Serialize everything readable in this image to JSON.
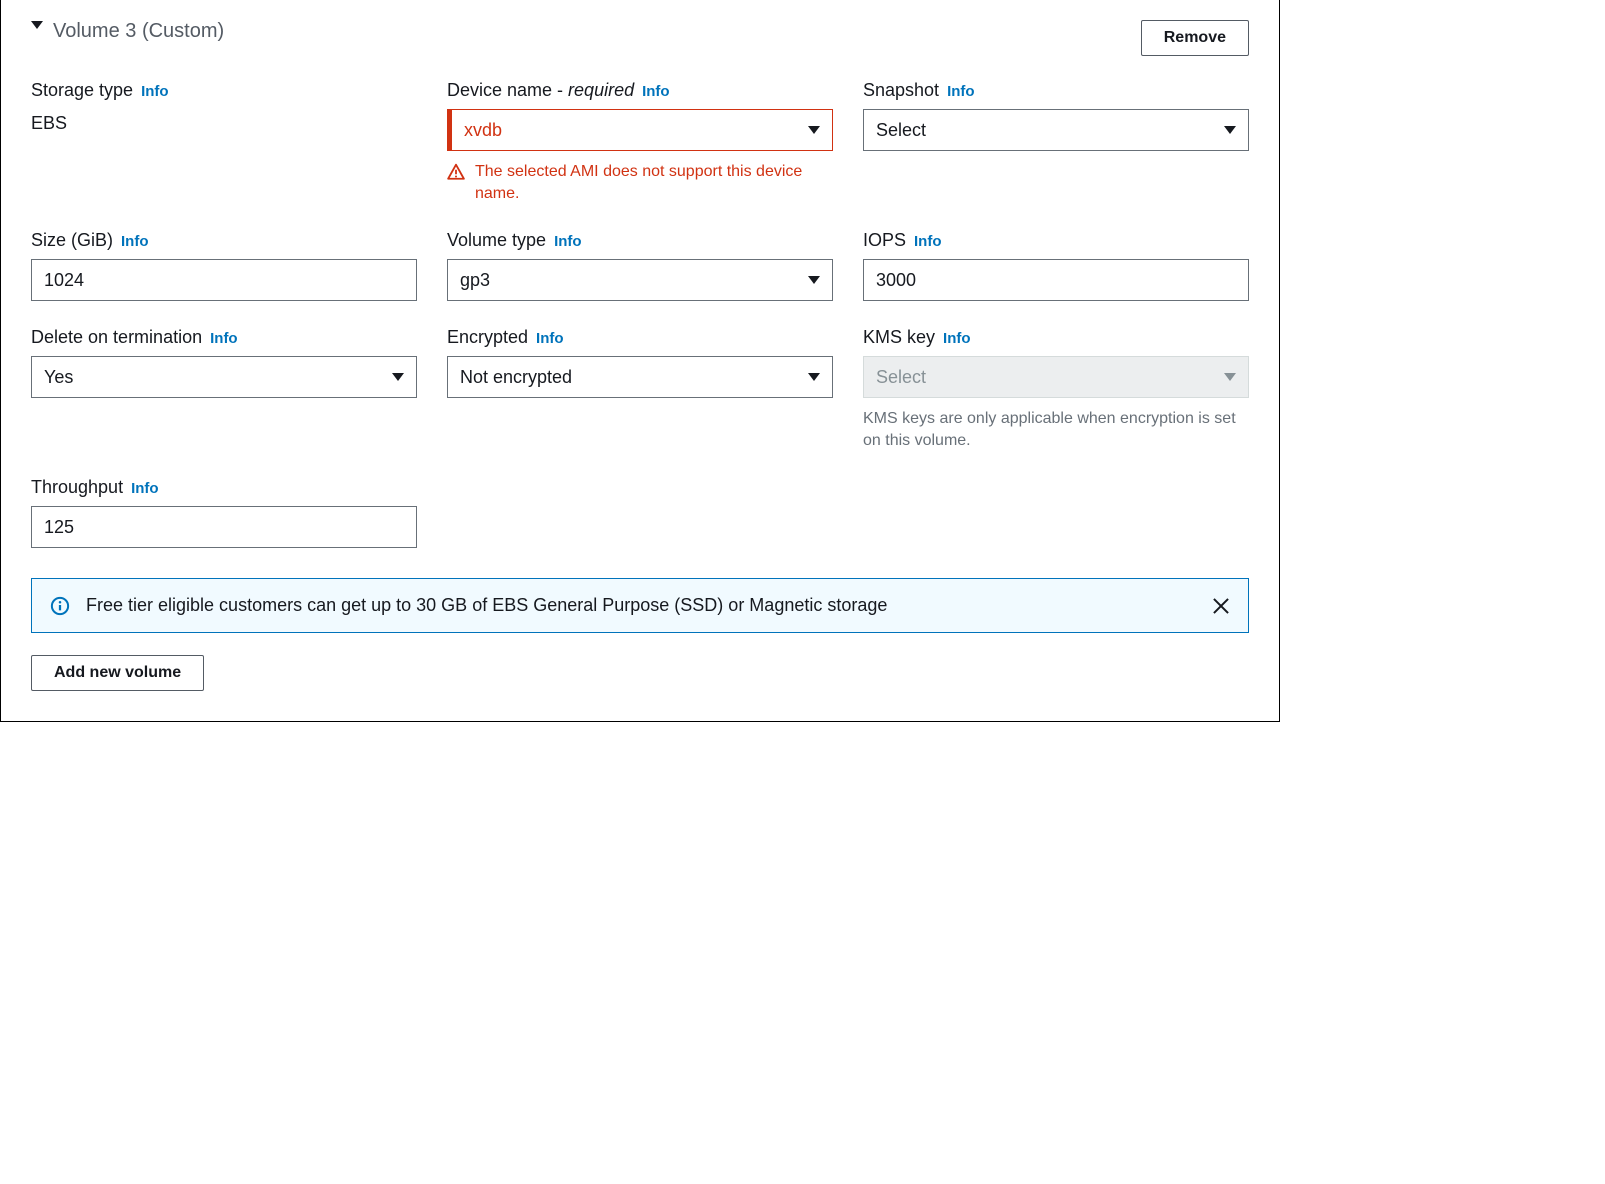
{
  "header": {
    "title": "Volume 3 (Custom)",
    "remove_label": "Remove"
  },
  "info_label": "Info",
  "fields": {
    "storage_type": {
      "label": "Storage type",
      "value": "EBS"
    },
    "device_name": {
      "label": "Device name - ",
      "required_label": "required",
      "value": "xvdb",
      "error": "The selected AMI does not support this device name."
    },
    "snapshot": {
      "label": "Snapshot",
      "value": "Select"
    },
    "size": {
      "label": "Size (GiB)",
      "value": "1024"
    },
    "volume_type": {
      "label": "Volume type",
      "value": "gp3"
    },
    "iops": {
      "label": "IOPS",
      "value": "3000"
    },
    "delete_on_term": {
      "label": "Delete on termination",
      "value": "Yes"
    },
    "encrypted": {
      "label": "Encrypted",
      "value": "Not encrypted"
    },
    "kms_key": {
      "label": "KMS key",
      "value": "Select",
      "help": "KMS keys are only applicable when encryption is set on this volume."
    },
    "throughput": {
      "label": "Throughput",
      "value": "125"
    }
  },
  "alert": {
    "message": "Free tier eligible customers can get up to 30 GB of EBS General Purpose (SSD) or Magnetic storage"
  },
  "footer": {
    "add_volume_label": "Add new volume"
  }
}
